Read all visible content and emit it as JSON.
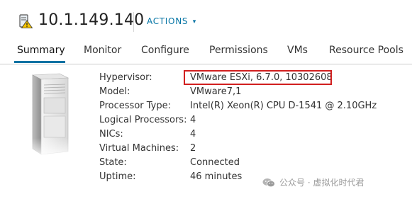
{
  "header": {
    "title": "10.1.149.140",
    "actions_label": "ACTIONS",
    "host_icon": "host-warning-icon"
  },
  "tabs": [
    {
      "label": "Summary",
      "active": true
    },
    {
      "label": "Monitor"
    },
    {
      "label": "Configure"
    },
    {
      "label": "Permissions"
    },
    {
      "label": "VMs"
    },
    {
      "label": "Resource Pools"
    }
  ],
  "summary": {
    "image": "server-tower-image",
    "properties": [
      {
        "label": "Hypervisor:",
        "value": "VMware ESXi, 6.7.0, 10302608",
        "highlighted": true
      },
      {
        "label": "Model:",
        "value": "VMware7,1"
      },
      {
        "label": "Processor Type:",
        "value": "Intel(R) Xeon(R) CPU D-1541 @ 2.10GHz"
      },
      {
        "label": "Logical Processors:",
        "value": "4"
      },
      {
        "label": "NICs:",
        "value": "4"
      },
      {
        "label": "Virtual Machines:",
        "value": "2"
      },
      {
        "label": "State:",
        "value": "Connected"
      },
      {
        "label": "Uptime:",
        "value": "46 minutes"
      }
    ]
  },
  "watermark": {
    "text": "公众号 · 虚拟化时代君",
    "icon": "wechat-icon"
  },
  "colors": {
    "accent": "#0072a3",
    "highlight_border": "#d11f1f",
    "warning": "#f5c400"
  }
}
